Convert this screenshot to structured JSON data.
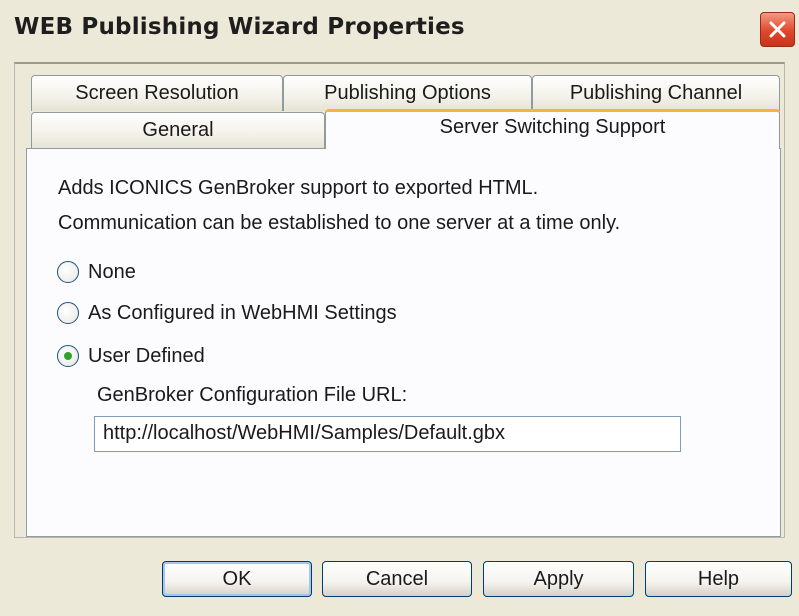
{
  "window": {
    "title": "WEB Publishing Wizard Properties",
    "close_icon": "close-icon"
  },
  "tabs": {
    "row1": [
      "Screen Resolution",
      "Publishing Options",
      "Publishing Channel"
    ],
    "row2": [
      "General",
      "Server Switching Support"
    ],
    "active": "Server Switching Support"
  },
  "content": {
    "description_line1": "Adds ICONICS GenBroker support to exported HTML.",
    "description_line2": "Communication can be established to one server at a time only.",
    "options": [
      {
        "label": "None",
        "selected": false
      },
      {
        "label": "As Configured in WebHMI Settings",
        "selected": false
      },
      {
        "label": "User Defined",
        "selected": true
      }
    ],
    "url_label": "GenBroker Configuration File URL:",
    "url_value": "http://localhost/WebHMI/Samples/Default.gbx"
  },
  "buttons": {
    "ok": "OK",
    "cancel": "Cancel",
    "apply": "Apply",
    "help": "Help"
  },
  "colors": {
    "dialog_bg": "#ECE9D8",
    "active_tab_accent": "#F7B33B",
    "close_button": "#E0482C",
    "radio_selected": "#2FA42C"
  }
}
